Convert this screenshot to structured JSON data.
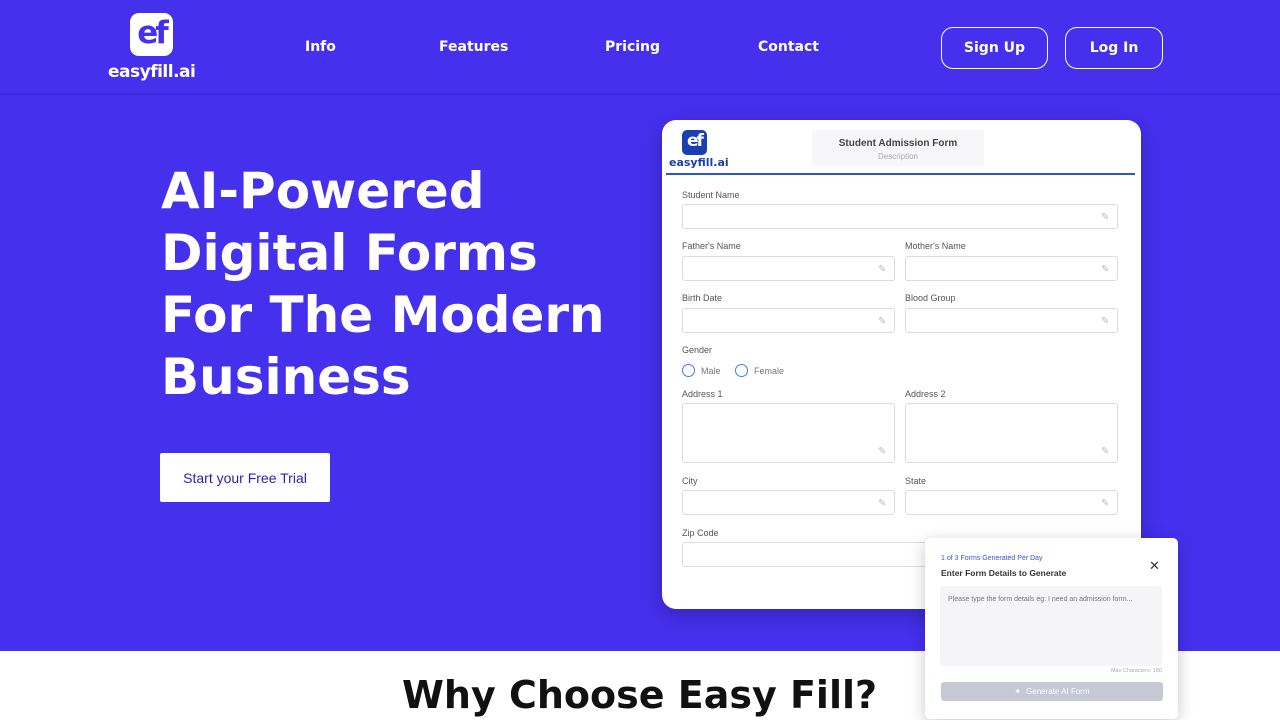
{
  "header": {
    "logo_mark": "ef",
    "logo_text": "easyfill.ai",
    "nav": [
      "Info",
      "Features",
      "Pricing",
      "Contact"
    ],
    "signup_label": "Sign Up",
    "login_label": "Log In"
  },
  "hero": {
    "headline": "AI-Powered Digital Forms For The Modern Business",
    "cta_label": "Start your Free Trial"
  },
  "form_preview": {
    "logo_mark": "ef",
    "logo_text": "easyfill.ai",
    "title": "Student Admission Form",
    "description": "Description",
    "fields": {
      "student_name": "Student Name",
      "fathers_name": "Father's Name",
      "mothers_name": "Mother's Name",
      "birth_date": "Birth Date",
      "blood_group": "Blood Group",
      "gender": "Gender",
      "gender_options": [
        "Male",
        "Female"
      ],
      "address1": "Address 1",
      "address2": "Address 2",
      "city": "City",
      "state": "State",
      "zip": "Zip Code"
    },
    "edit_icon": "pencil-icon"
  },
  "generator": {
    "counter": "1 of 3 Forms Generated Per Day",
    "title": "Enter Form Details to Generate",
    "placeholder": "Please type the form details eg: I need an admission form...",
    "max_chars": "Max Characters: 180",
    "button_label": "Generate AI Form",
    "close_icon": "close-icon",
    "sparkle_icon": "sparkle-icon"
  },
  "section": {
    "title": "Why Choose Easy Fill?"
  },
  "colors": {
    "brand": "#4530ee",
    "card_accent": "#2f56c7",
    "button_disabled": "#c4c9d4"
  }
}
